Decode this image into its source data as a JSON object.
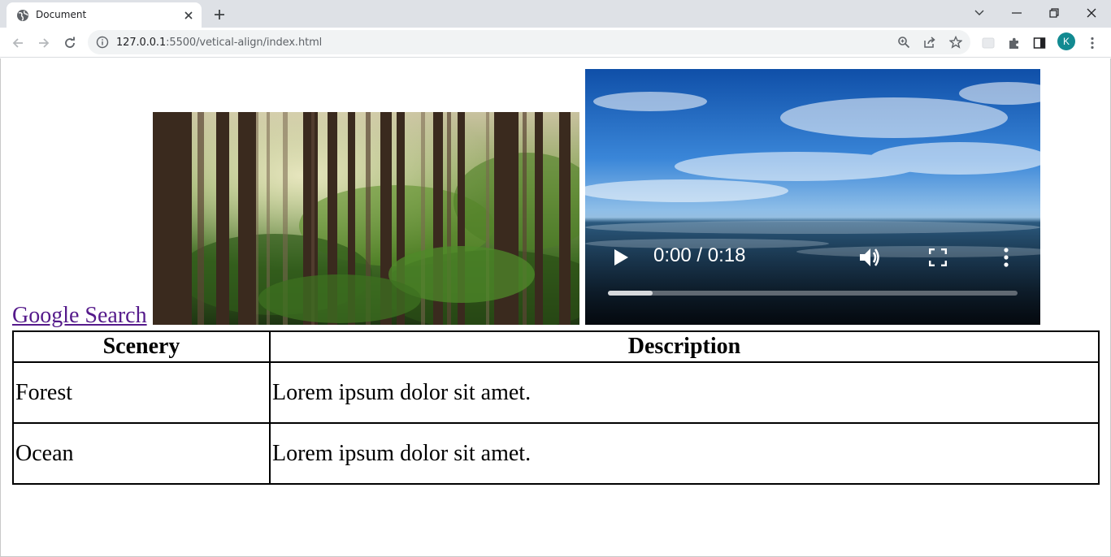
{
  "browser": {
    "tab_title": "Document",
    "url_host": "127.0.0.1",
    "url_rest": ":5500/vetical-align/index.html",
    "avatar_letter": "K",
    "avatar_color": "#128a91"
  },
  "page": {
    "link_text": "Google Search",
    "video": {
      "time_display": "0:00 / 0:18",
      "buffered_fraction": 0.11
    },
    "table": {
      "headers": [
        "Scenery",
        "Description"
      ],
      "rows": [
        [
          "Forest",
          "Lorem ipsum dolor sit amet."
        ],
        [
          "Ocean",
          "Lorem ipsum dolor sit amet."
        ]
      ]
    }
  }
}
